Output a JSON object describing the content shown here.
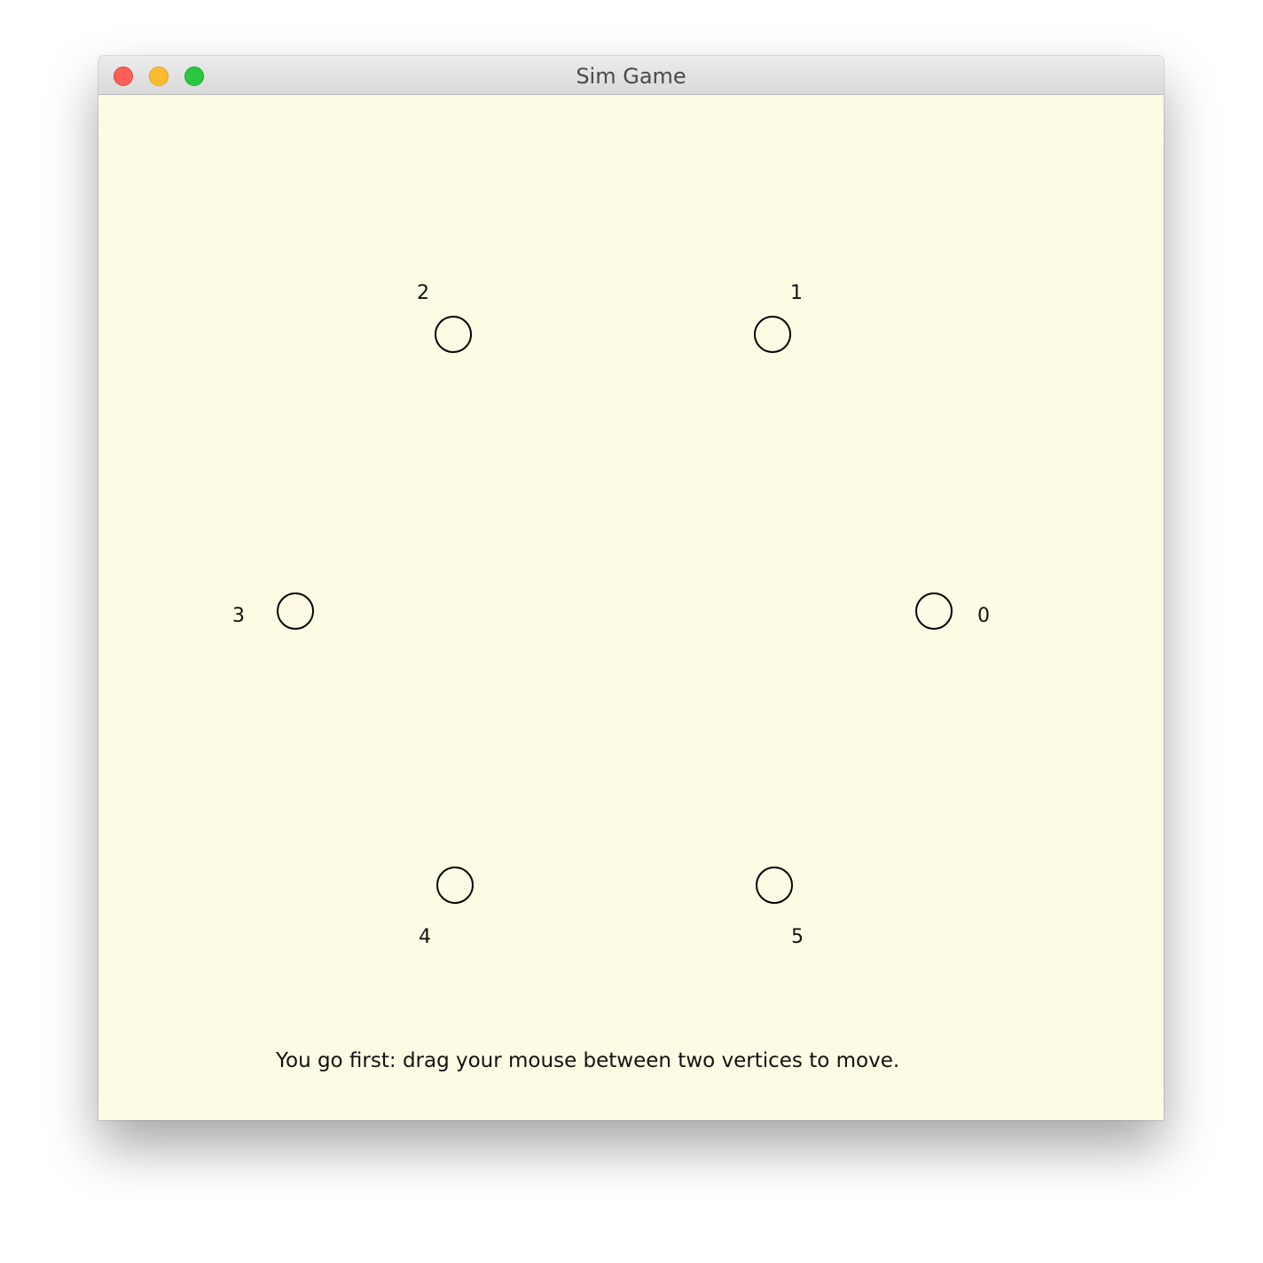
{
  "window": {
    "title": "Sim Game",
    "background": "#fefbe4"
  },
  "board": {
    "vertices": [
      {
        "id": 0,
        "label": "0"
      },
      {
        "id": 1,
        "label": "1"
      },
      {
        "id": 2,
        "label": "2"
      },
      {
        "id": 3,
        "label": "3"
      },
      {
        "id": 4,
        "label": "4"
      },
      {
        "id": 5,
        "label": "5"
      }
    ],
    "edges": []
  },
  "status": {
    "message": "You go first: drag your mouse between two vertices to move."
  }
}
